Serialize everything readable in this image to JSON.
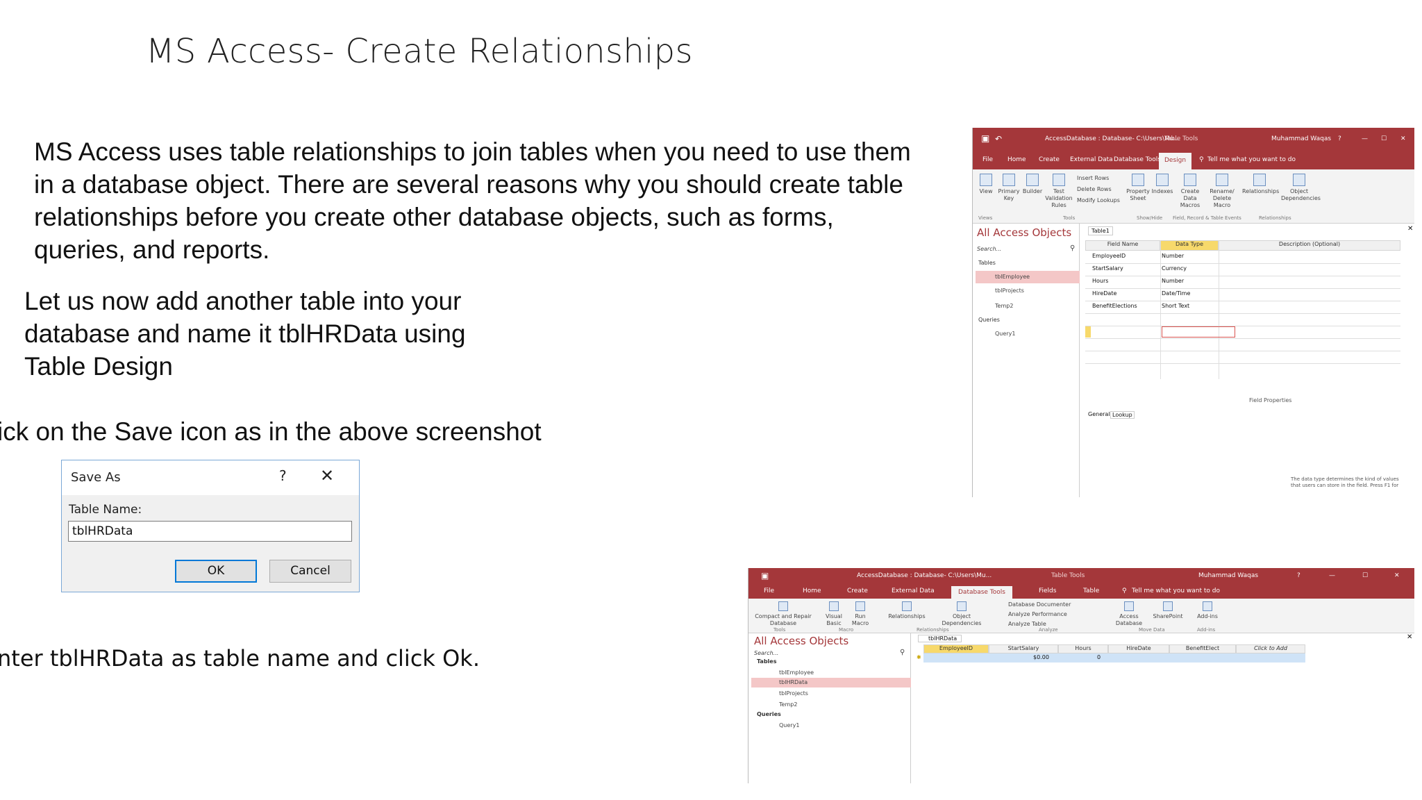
{
  "slide": {
    "title": "MS Access- Create Relationships",
    "para1": "MS Access uses table relationships to join tables when you need to use them in a database object. There are several reasons why you should create table relationships before you create other database objects, such as forms, queries, and reports.",
    "para2": "Let us now add another table into your database and name it tblHRData using Table Design",
    "instruction_save": "ick on the Save icon as in the above screenshot",
    "instruction_enter": "nter tblHRData as table name and click Ok."
  },
  "dialog": {
    "title": "Save As",
    "help": "?",
    "close": "✕",
    "label": "Table Name:",
    "value": "tblHRData",
    "ok": "OK",
    "cancel": "Cancel"
  },
  "win1": {
    "title": "AccessDatabase : Database- C:\\Users\\Mu...",
    "context": "Table Tools",
    "user": "Muhammad Waqas",
    "tabs": [
      "File",
      "Home",
      "Create",
      "External Data",
      "Database Tools",
      "Design"
    ],
    "tell": "Tell me what you want to do",
    "ribbon": {
      "view": "View",
      "primary_key": "Primary Key",
      "builder": "Builder",
      "test_validation": "Test Validation Rules",
      "insert_rows": "Insert Rows",
      "delete_rows": "Delete Rows",
      "modify_lookups": "Modify Lookups",
      "property_sheet": "Property Sheet",
      "indexes": "Indexes",
      "create_data_macros": "Create Data Macros",
      "rename_delete_macro": "Rename/ Delete Macro",
      "relationships": "Relationships",
      "object_dependencies": "Object Dependencies",
      "groups": [
        "Views",
        "Tools",
        "Show/Hide",
        "Field, Record & Table Events",
        "Relationships"
      ]
    },
    "nav": {
      "header": "All Access Objects",
      "search": "Search...",
      "tables_label": "Tables",
      "tables": [
        "tblEmployee",
        "tblProjects",
        "Temp2"
      ],
      "queries_label": "Queries",
      "queries": [
        "Query1"
      ]
    },
    "doc_tab": "Table1",
    "columns": [
      "Field Name",
      "Data Type",
      "Description (Optional)"
    ],
    "rows": [
      [
        "EmployeeID",
        "Number"
      ],
      [
        "StartSalary",
        "Currency"
      ],
      [
        "Hours",
        "Number"
      ],
      [
        "HireDate",
        "Date/Time"
      ],
      [
        "BenefitElections",
        "Short Text"
      ]
    ],
    "field_properties": "Field Properties",
    "prop_tabs": [
      "General",
      "Lookup"
    ],
    "hint": "The data type determines the kind of values that users can store in the field. Press F1 for"
  },
  "win2": {
    "title": "AccessDatabase : Database- C:\\Users\\Mu...",
    "context": "Table Tools",
    "user": "Muhammad Waqas",
    "tabs": [
      "File",
      "Home",
      "Create",
      "External Data",
      "Database Tools",
      "Fields",
      "Table"
    ],
    "tell": "Tell me what you want to do",
    "ribbon": {
      "compact": "Compact and Repair Database",
      "visual_basic": "Visual Basic",
      "run_macro": "Run Macro",
      "relationships": "Relationships",
      "object_dependencies": "Object Dependencies",
      "db_documenter": "Database Documenter",
      "analyze_performance": "Analyze Performance",
      "analyze_table": "Analyze Table",
      "access_db": "Access Database",
      "sharepoint": "SharePoint",
      "addins": "Add-ins",
      "groups": [
        "Tools",
        "Macro",
        "Relationships",
        "Analyze",
        "Move Data",
        "Add-ins"
      ]
    },
    "nav": {
      "header": "All Access Objects",
      "search": "Search...",
      "tables_label": "Tables",
      "tables": [
        "tblEmployee",
        "tblHRData",
        "tblProjects",
        "Temp2"
      ],
      "queries_label": "Queries",
      "queries": [
        "Query1"
      ]
    },
    "doc_tab": "tblHRData",
    "columns": [
      "EmployeeID",
      "StartSalary",
      "Hours",
      "HireDate",
      "BenefitElect",
      "Click to Add"
    ],
    "row": [
      "",
      "$0.00",
      "0"
    ]
  },
  "colors": {
    "access_red": "#a4373a",
    "selection": "#f4c7c7",
    "ok_border": "#0078d7"
  }
}
